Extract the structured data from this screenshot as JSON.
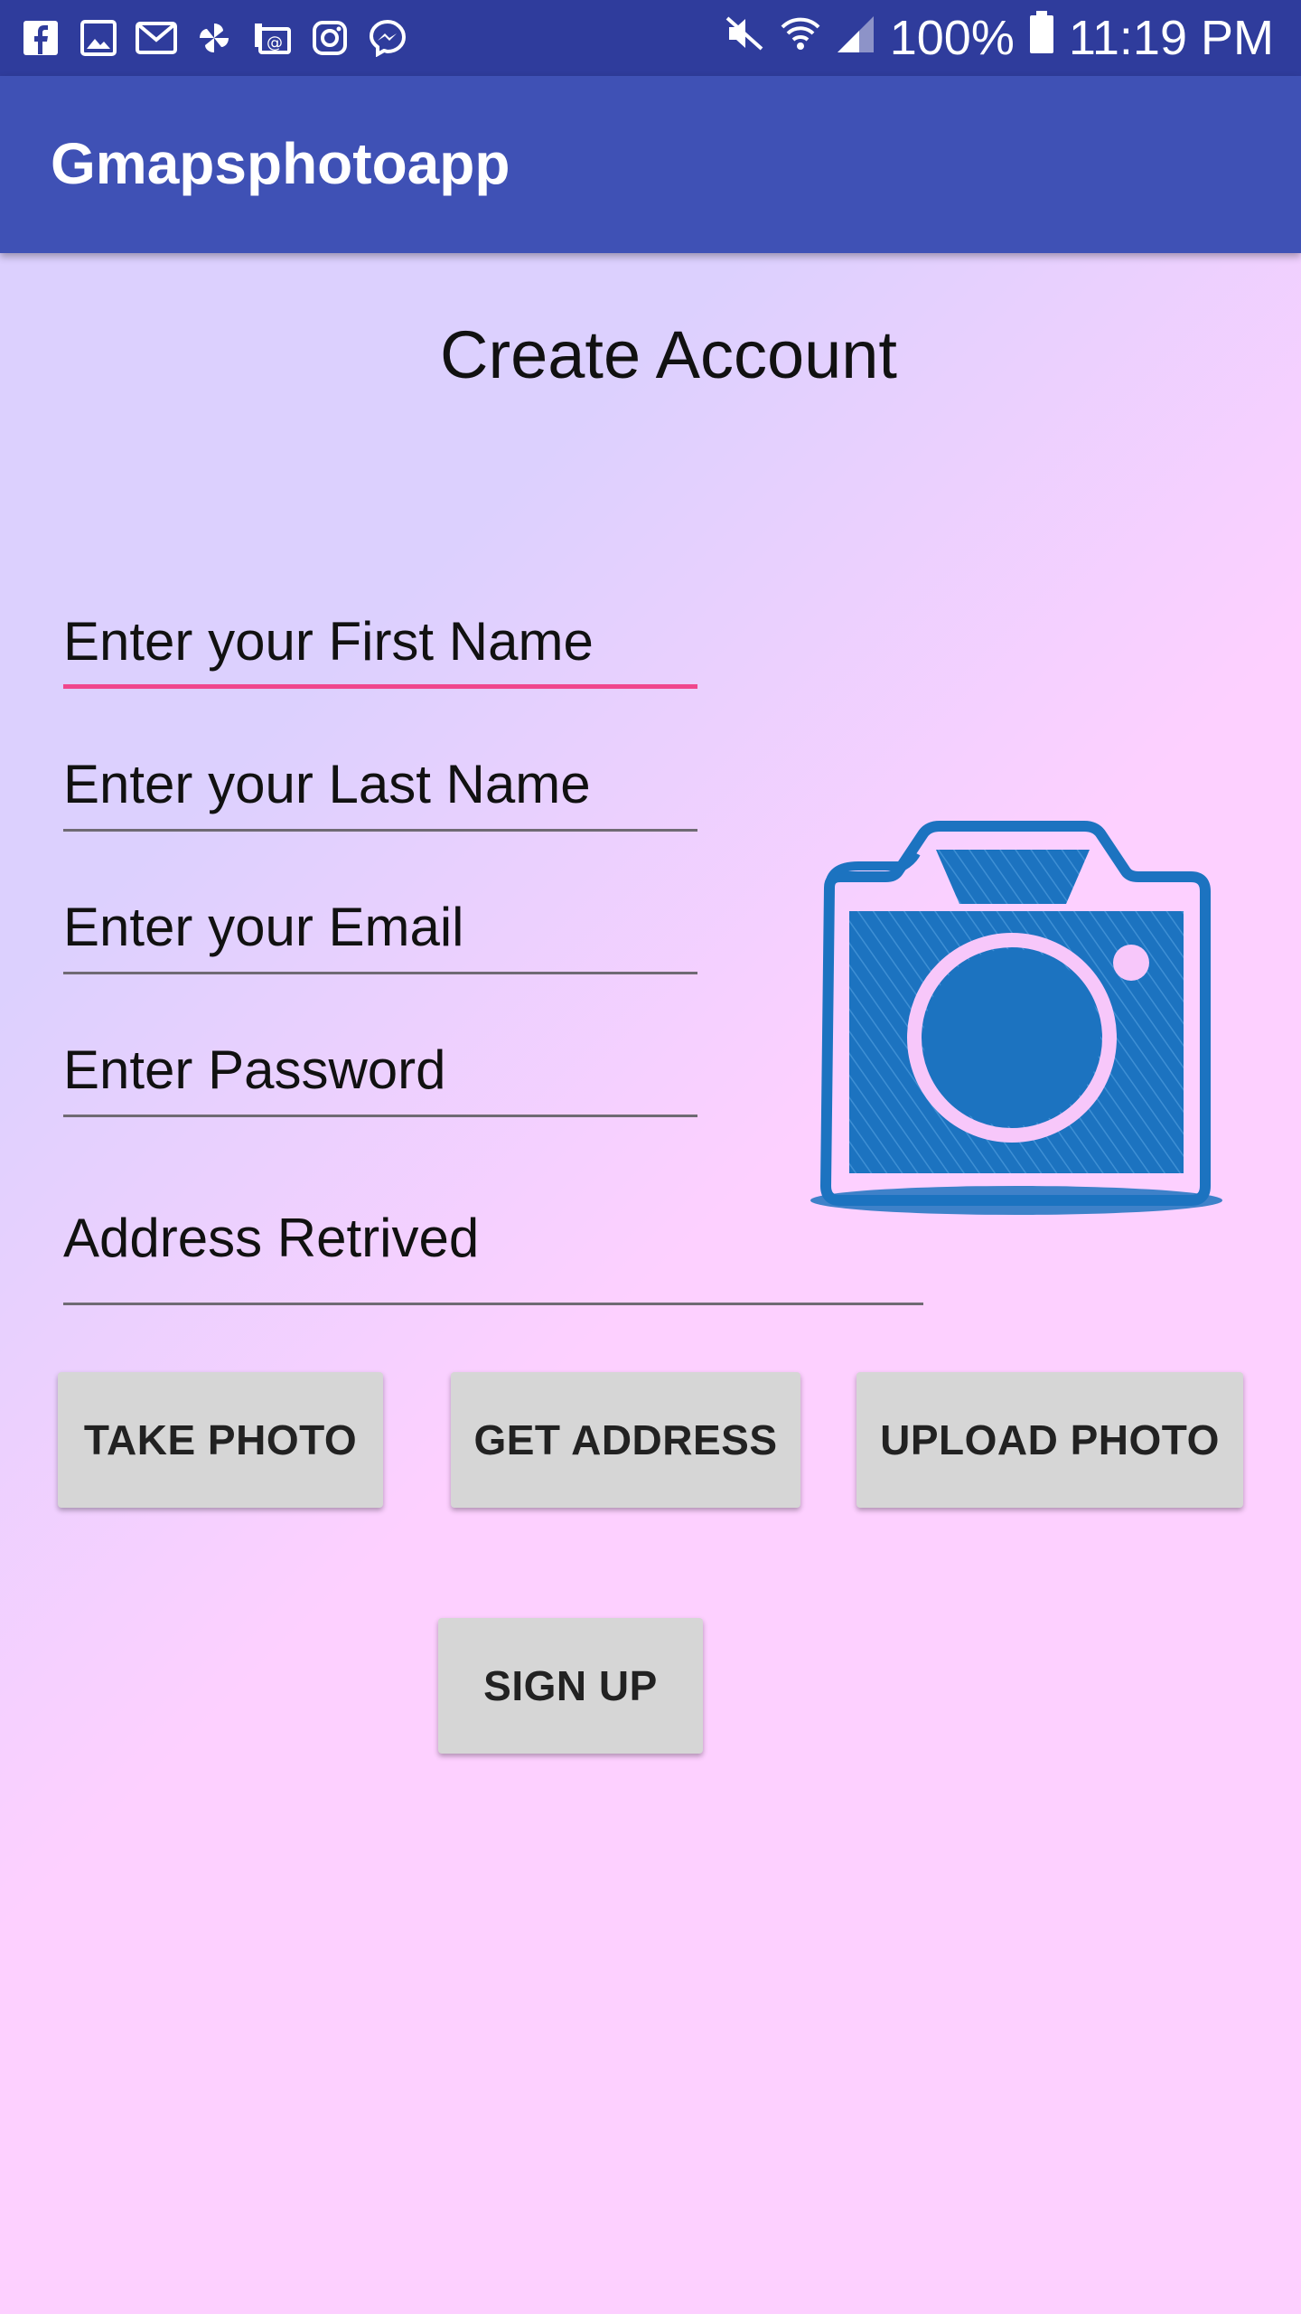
{
  "status_bar": {
    "battery": "100%",
    "time": "11:19 PM",
    "left_icons": [
      "facebook-icon",
      "gallery-icon",
      "gmail-icon",
      "pinwheel-icon",
      "email-icon",
      "instagram-icon",
      "messenger-icon"
    ],
    "right_icons": [
      "mute-icon",
      "wifi-icon",
      "signal-icon",
      "battery-icon"
    ]
  },
  "app_bar": {
    "title": "Gmapsphotoapp"
  },
  "form": {
    "heading": "Create Account",
    "first_name_placeholder": "Enter your First Name",
    "last_name_placeholder": "Enter your Last Name",
    "email_placeholder": "Enter your Email",
    "password_placeholder": "Enter Password",
    "address_placeholder": "Address Retrived"
  },
  "buttons": {
    "take_photo": "TAKE PHOTO",
    "get_address": "GET ADDRESS",
    "upload_photo": "UPLOAD PHOTO",
    "sign_up": "SIGN UP"
  },
  "colors": {
    "status_bar": "#2f3c9c",
    "app_bar": "#3f51b5",
    "accent": "#f0468c",
    "camera": "#1c73c0"
  }
}
